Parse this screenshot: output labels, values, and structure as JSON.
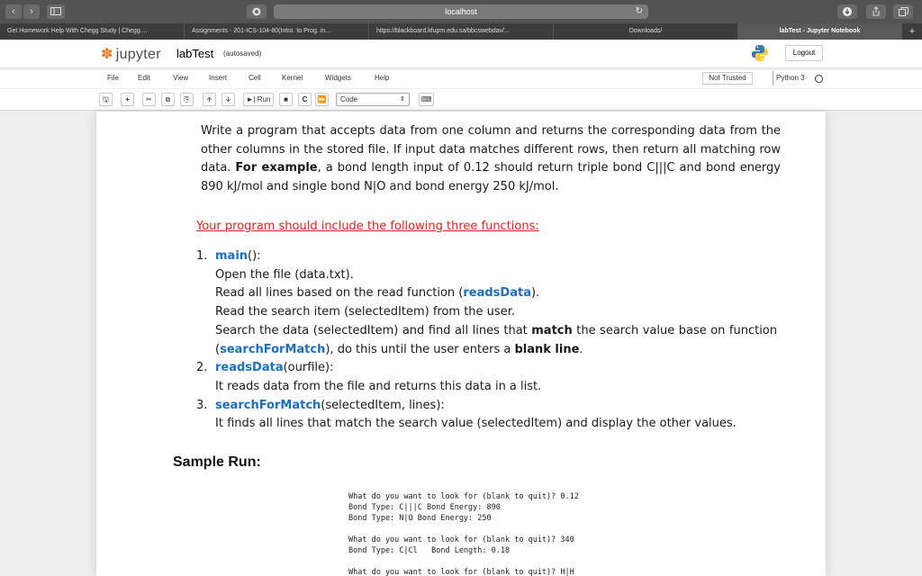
{
  "browser": {
    "url": "localhost",
    "tabs": [
      "Get Homework Help With Chegg Study | Chegg....",
      "Assignments - 201-ICS-104-80(Intro. to Prog. in...",
      "https://blackboard.kfupm.edu.sa/bbcswebdav/...",
      "Downloads/",
      "labTest - Jupyter Notebook"
    ],
    "new_tab": "+"
  },
  "jupyter": {
    "logo_text": "jupyter",
    "notebook_name": "labTest",
    "save_status": "(autosaved)",
    "logout_label": "Logout",
    "menu": [
      "File",
      "Edit",
      "View",
      "Insert",
      "Cell",
      "Kernel",
      "Widgets",
      "Help"
    ],
    "trust_status": "Not Trusted",
    "kernel_name": "Python 3",
    "toolbar": {
      "run_label": "Run",
      "cell_type": "Code"
    }
  },
  "content": {
    "intro": {
      "p1": "Write a program that accepts data from one column and returns the corresponding data from the other columns in the stored file. If input data matches different rows, then return all matching row data. ",
      "for_example": "For example",
      "p2": ", a bond length input of 0.12 should return triple bond C|||C and bond energy 890 kJ/mol and single bond N|O and bond energy 250 kJ/mol."
    },
    "requirements_heading": "Your program should include the following three functions:",
    "functions": [
      {
        "number": "1.",
        "name": "main",
        "signature": "():",
        "lines": [
          "Open the file (data.txt).",
          "Read all lines based on the read function (",
          "readsData",
          ").",
          "Read the search item (selectedItem) from the user.",
          "Search the data (selectedItem) and find all lines that ",
          "match",
          " the search value base on function (",
          "searchForMatch",
          "), do this until the user enters a ",
          "blank line",
          "."
        ]
      },
      {
        "number": "2.",
        "name": "readsData",
        "signature": "(ourfile):",
        "lines": [
          "It reads data from the file and returns this data in a list."
        ]
      },
      {
        "number": "3.",
        "name": "searchForMatch",
        "signature": "(selectedItem, lines):",
        "lines": [
          "It finds all lines that match the search value (selectedItem) and display the other values."
        ]
      }
    ],
    "sample_heading": "Sample Run:",
    "sample_run": [
      "What do you want to look for (blank to quit)? 0.12",
      "Bond Type: C|||C Bond Energy: 890",
      "Bond Type: N|O Bond Energy: 250",
      "What do you want to look for (blank to quit)? 340",
      "Bond Type: C|Cl   Bond Length: 0.18",
      "What do you want to look for (blank to quit)? H|H"
    ]
  }
}
